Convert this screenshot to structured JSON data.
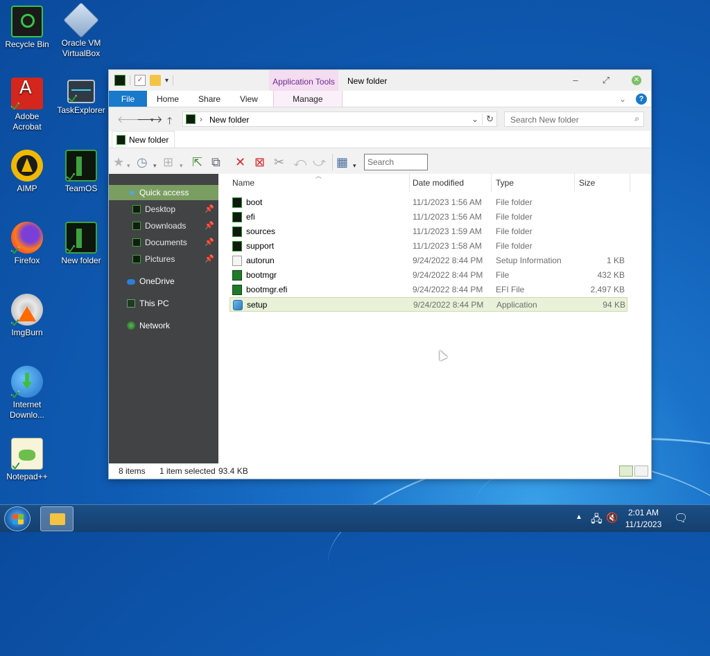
{
  "desktop": {
    "icons": [
      {
        "label": "Recycle Bin"
      },
      {
        "label": "Oracle VM VirtualBox"
      },
      {
        "label": "Adobe Acrobat"
      },
      {
        "label": "TaskExplorer"
      },
      {
        "label": "AIMP"
      },
      {
        "label": "TeamOS"
      },
      {
        "label": "Firefox"
      },
      {
        "label": "New folder"
      },
      {
        "label": "ImgBurn"
      },
      {
        "label": "Internet Downlo..."
      },
      {
        "label": "Notepad++"
      }
    ]
  },
  "window": {
    "context_tab_group": "Application Tools",
    "title": "New folder",
    "ribbon_tabs": [
      "File",
      "Home",
      "Share",
      "View"
    ],
    "manage_tab": "Manage",
    "address": {
      "path": "New folder"
    },
    "search_placeholder": "Search New folder",
    "folder_tab": "New folder",
    "toolbar_search_placeholder": "Search",
    "nav": {
      "quick_access": "Quick access",
      "pinned": [
        "Desktop",
        "Downloads",
        "Documents",
        "Pictures"
      ],
      "onedrive": "OneDrive",
      "this_pc": "This PC",
      "network": "Network"
    },
    "columns": {
      "name": "Name",
      "date": "Date modified",
      "type": "Type",
      "size": "Size"
    },
    "files": [
      {
        "name": "boot",
        "date": "11/1/2023 1:56 AM",
        "type": "File folder",
        "size": ""
      },
      {
        "name": "efi",
        "date": "11/1/2023 1:56 AM",
        "type": "File folder",
        "size": ""
      },
      {
        "name": "sources",
        "date": "11/1/2023 1:59 AM",
        "type": "File folder",
        "size": ""
      },
      {
        "name": "support",
        "date": "11/1/2023 1:58 AM",
        "type": "File folder",
        "size": ""
      },
      {
        "name": "autorun",
        "date": "9/24/2022 8:44 PM",
        "type": "Setup Information",
        "size": "1 KB"
      },
      {
        "name": "bootmgr",
        "date": "9/24/2022 8:44 PM",
        "type": "File",
        "size": "432 KB"
      },
      {
        "name": "bootmgr.efi",
        "date": "9/24/2022 8:44 PM",
        "type": "EFI File",
        "size": "2,497 KB"
      },
      {
        "name": "setup",
        "date": "9/24/2022 8:44 PM",
        "type": "Application",
        "size": "94 KB"
      }
    ],
    "status": {
      "items": "8 items",
      "selected": "1 item selected",
      "selected_size": "93.4 KB"
    }
  },
  "taskbar": {
    "time": "2:01 AM",
    "date": "11/1/2023"
  },
  "colors": {
    "file_tab_blue": "#1979ca",
    "nav_pane_bg": "#424345",
    "nav_selected": "#7a9e62",
    "selected_row": "#e9f2d9",
    "app_tools_bg": "#f4dcf1"
  }
}
